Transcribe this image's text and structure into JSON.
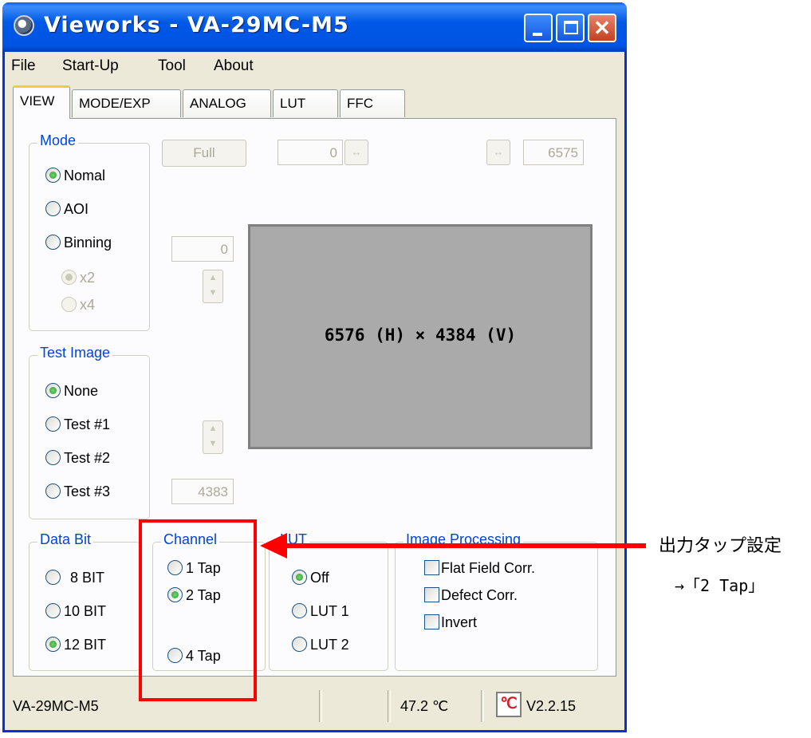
{
  "window": {
    "title": "Vieworks - VA-29MC-M5",
    "title_bar_color": "#0054e3"
  },
  "menu": [
    "File",
    "Start-Up",
    "Tool",
    "About"
  ],
  "tabs": [
    "VIEW",
    "MODE/EXP",
    "ANALOG",
    "LUT",
    "FFC"
  ],
  "active_tab": "VIEW",
  "view": {
    "full_button": "Full",
    "h_start": "0",
    "h_end": "6575",
    "v_start": "0",
    "v_end": "4383",
    "resolution_text": "6576 (H) × 4384 (V)"
  },
  "mode": {
    "title": "Mode",
    "options": [
      "Nomal",
      "AOI",
      "Binning"
    ],
    "selected": "Nomal",
    "binning_options": [
      "x2",
      "x4"
    ],
    "binning_selected": "x2"
  },
  "test_image": {
    "title": "Test Image",
    "options": [
      "None",
      "Test #1",
      "Test #2",
      "Test #3"
    ],
    "selected": "None"
  },
  "data_bit": {
    "title": "Data Bit",
    "options": [
      "8 BIT",
      "10 BIT",
      "12 BIT"
    ],
    "selected": "12 BIT"
  },
  "channel": {
    "title": "Channel",
    "options": [
      "1 Tap",
      "2 Tap",
      "4 Tap"
    ],
    "selected": "2 Tap"
  },
  "lut": {
    "title": "LUT",
    "options": [
      "Off",
      "LUT 1",
      "LUT 2"
    ],
    "selected": "Off"
  },
  "image_processing": {
    "title": "Image Processing",
    "options": [
      "Flat Field Corr.",
      "Defect Corr.",
      "Invert"
    ],
    "checked": []
  },
  "status": {
    "model": "VA-29MC-M5",
    "temperature": "47.2 ℃",
    "version": "V2.2.15"
  },
  "annotation": {
    "line1": "出力タップ設定",
    "line2": "→「2 Tap」",
    "color": "#ff0000"
  }
}
